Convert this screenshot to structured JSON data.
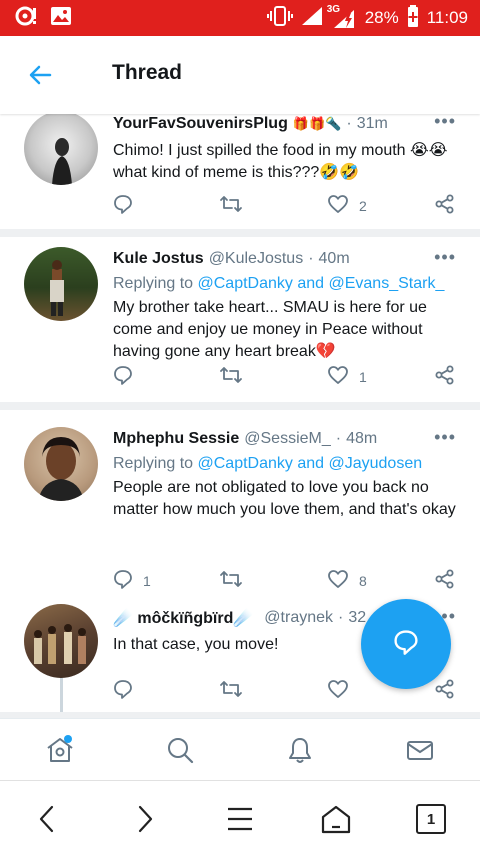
{
  "status_bar": {
    "network_type": "3G",
    "battery_percent": "28%",
    "time": "11:09"
  },
  "header": {
    "title": "Thread"
  },
  "tweets": [
    {
      "display_name": "YourFavSouvenirsPlug",
      "name_emoji": "🎁🎁🔦",
      "handle": "",
      "dot": "·",
      "time": "31m",
      "reply_prefix": "",
      "reply_to_1": "",
      "reply_and": "",
      "reply_to_2": "",
      "text": "Chimo! I just spilled the food in my mouth 😭😭 what kind of meme is this???🤣🤣",
      "reply_count": "",
      "like_count": "2"
    },
    {
      "display_name": "Kule Jostus",
      "name_emoji": "",
      "handle": "@KuleJostus",
      "dot": "·",
      "time": "40m",
      "reply_prefix": "Replying to ",
      "reply_to_1": "@CaptDanky",
      "reply_and": " and ",
      "reply_to_2": "@Evans_Stark_",
      "text": "My brother take heart... SMAU is here for ue come and enjoy ue money in Peace without having gone any heart break💔",
      "reply_count": "",
      "like_count": "1"
    },
    {
      "display_name": "Mphephu Sessie",
      "name_emoji": "",
      "handle": "@SessieM_",
      "dot": "·",
      "time": "48m",
      "reply_prefix": "Replying to ",
      "reply_to_1": "@CaptDanky",
      "reply_and": " and ",
      "reply_to_2": "@Jayudosen",
      "text": "People are not obligated to love you back no matter how much you love them, and that's okay",
      "reply_count": "1",
      "like_count": "8"
    },
    {
      "display_name": "☄️ môčkïñgbïrd☄️",
      "name_emoji": "",
      "handle": "@traynek",
      "dot": "·",
      "time": "32",
      "reply_prefix": "",
      "reply_to_1": "",
      "reply_and": "",
      "reply_to_2": "",
      "text": "In that case, you move!",
      "reply_count": "",
      "like_count": ""
    }
  ],
  "browser": {
    "tab_count": "1"
  },
  "colors": {
    "accent": "#1da1f2",
    "status_bar": "#e0201d",
    "muted": "#657786"
  }
}
